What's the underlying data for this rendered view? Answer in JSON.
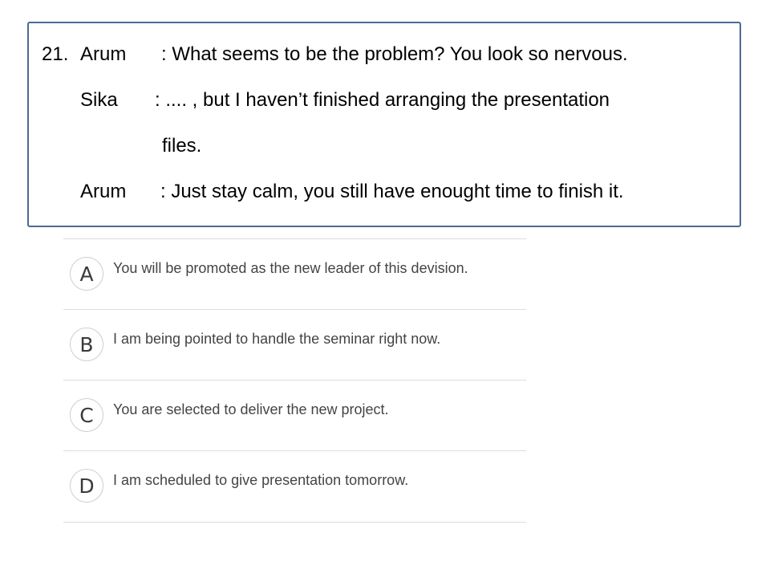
{
  "question": {
    "number": "21.",
    "lines": [
      {
        "speaker": "Arum",
        "text": ": What seems to be the problem? You look so nervous."
      },
      {
        "speaker": "Sika",
        "text": ": .... , but I haven’t finished arranging the presentation"
      },
      {
        "speaker": "",
        "text": "files."
      },
      {
        "speaker": "Arum",
        "text": ": Just stay calm, you still have enought time to finish it."
      }
    ]
  },
  "options": [
    {
      "letter": "A",
      "text": "You will be promoted as the new leader of this devision."
    },
    {
      "letter": "B",
      "text": "I am being pointed to handle the seminar right now."
    },
    {
      "letter": "C",
      "text": "You are selected to deliver the new project."
    },
    {
      "letter": "D",
      "text": "I am scheduled to give presentation tomorrow."
    }
  ],
  "colors": {
    "box_border": "#4a6a95",
    "divider": "#dcdcdc",
    "option_text": "#444444"
  }
}
